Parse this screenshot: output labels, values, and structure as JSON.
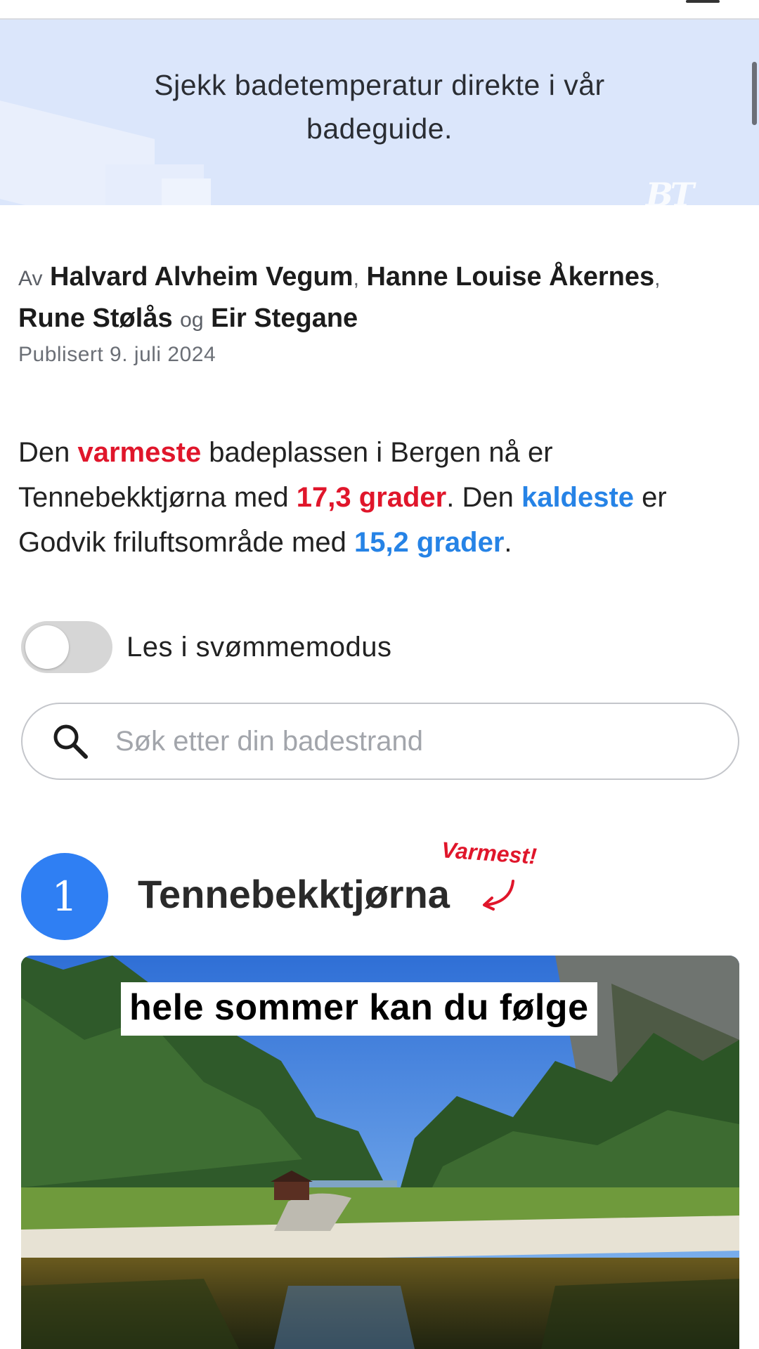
{
  "banner": {
    "text": "Sjekk badetemperatur direkte i vår badeguide.",
    "logo": "BT"
  },
  "byline": {
    "prefix": "Av",
    "authors": [
      "Halvard Alvheim Vegum",
      "Hanne Louise Åkernes",
      "Rune Stølås",
      "Eir Stegane"
    ],
    "separator": ",",
    "conjunction": "og",
    "published": "Publisert 9. juli 2024"
  },
  "intro": {
    "part1": "Den ",
    "warm_word": "varmeste",
    "part2": " badeplassen i Bergen nå er Tennebekktjørna med ",
    "warm_temp": "17,3 grader",
    "part3": ". Den ",
    "cold_word": "kaldeste",
    "part4": " er Godvik friluftsområde med ",
    "cold_temp": "15,2 grader",
    "part5": ".",
    "warm_color": "#e0162b",
    "cold_color": "#2683e6"
  },
  "swim_mode": {
    "label": "Les i svømmemodus",
    "enabled": false
  },
  "search": {
    "placeholder": "Søk etter din badestrand",
    "icon": "search-icon"
  },
  "beaches": [
    {
      "rank": "1",
      "name": "Tennebekktjørna",
      "tag": "Varmest!",
      "caption": "hele sommer kan du følge"
    }
  ],
  "colors": {
    "accent": "#2f7ff3",
    "banner_bg": "#dbe6fb"
  }
}
